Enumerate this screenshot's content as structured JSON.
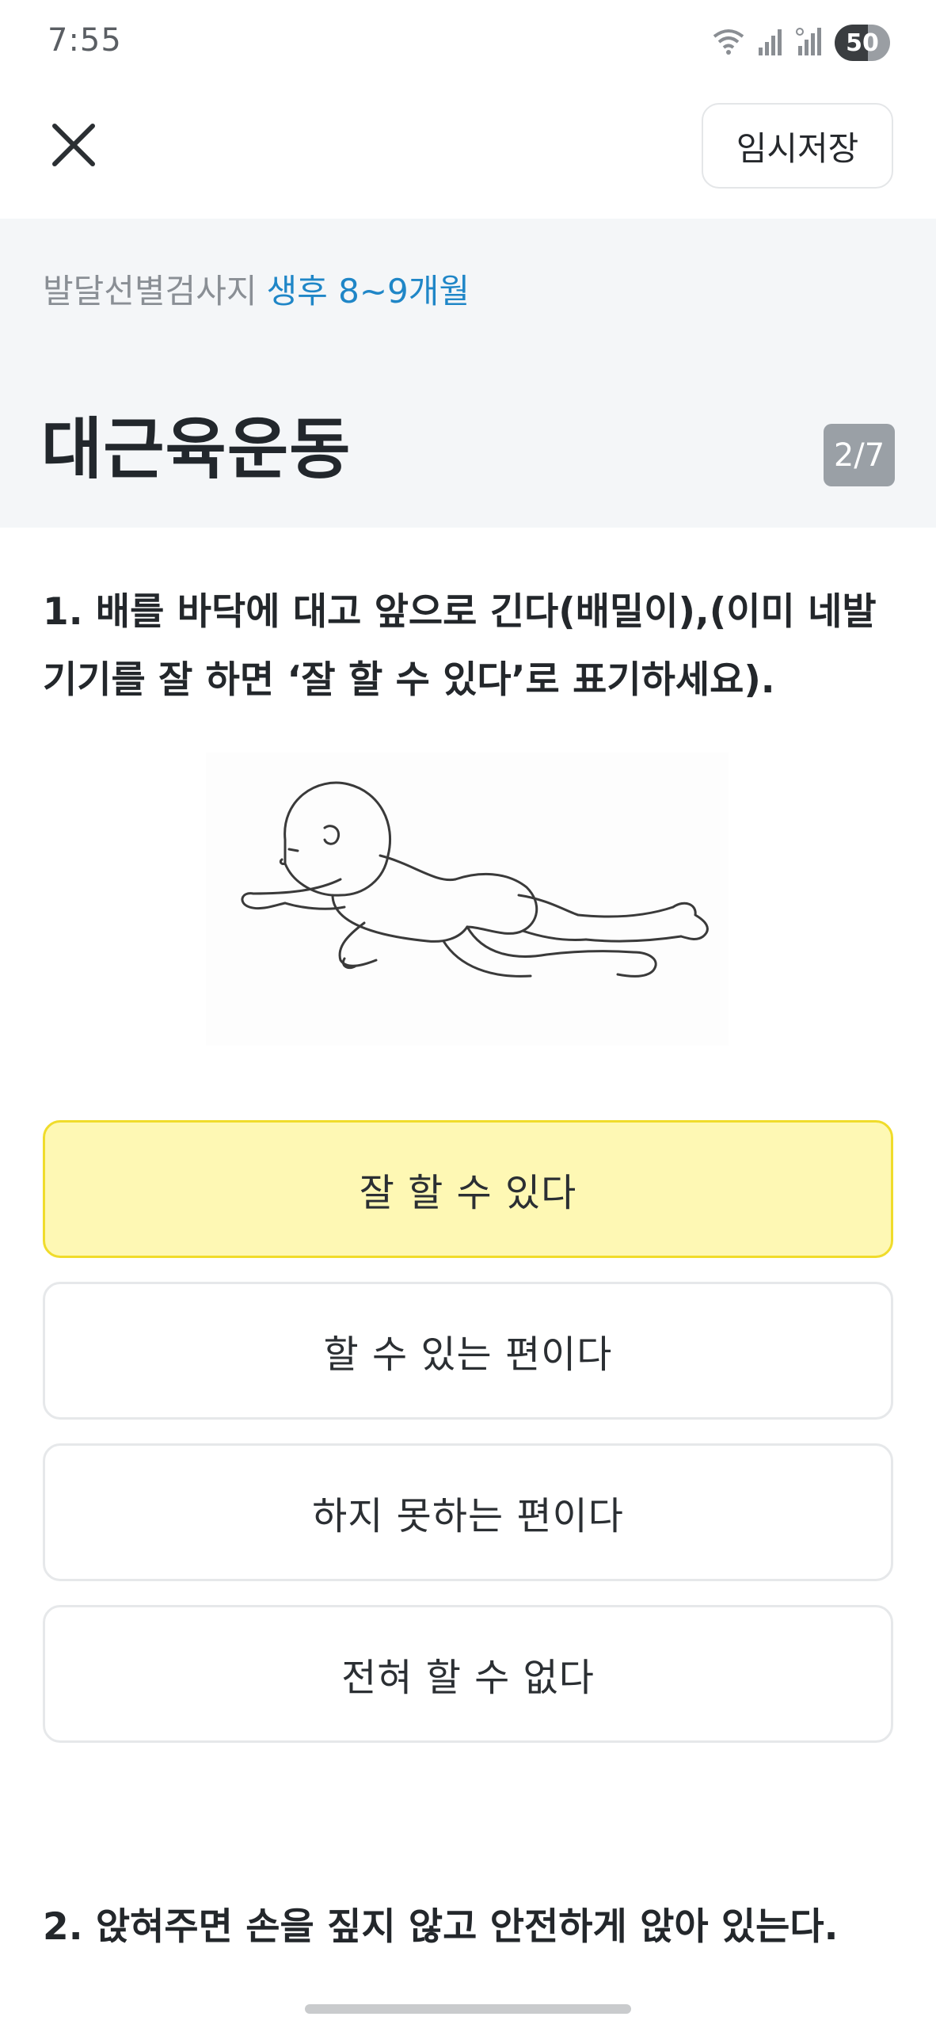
{
  "status_bar": {
    "time": "7:55",
    "battery": "50",
    "icons": [
      "wifi-icon",
      "signal-icon",
      "roaming-signal-icon"
    ]
  },
  "top_bar": {
    "close_icon": "close-icon",
    "save_label": "임시저장"
  },
  "header": {
    "form_name": "발달선별검사지",
    "age_range": "생후 8~9개월",
    "section_title": "대근육운동",
    "page_indicator": "2/7",
    "accent_color": "#1f86c7"
  },
  "questions": [
    {
      "text": "1. 배를 바닥에 대고 앞으로 긴다(배밀이),(이미 네발 기기를 잘 하면 ‘잘 할 수 있다’로 표기하세요).",
      "illustration": "baby-crawling-illustration",
      "options": [
        {
          "label": "잘 할 수 있다",
          "selected": true
        },
        {
          "label": "할 수 있는 편이다",
          "selected": false
        },
        {
          "label": "하지 못하는 편이다",
          "selected": false
        },
        {
          "label": "전혀 할 수 없다",
          "selected": false
        }
      ]
    },
    {
      "text": "2. 앉혀주면 손을 짚지 않고 안전하게 앉아 있는다."
    }
  ],
  "colors": {
    "selected_background": "#fef8b4",
    "selected_border": "#f0dc2b",
    "header_background": "#f4f6f8"
  }
}
